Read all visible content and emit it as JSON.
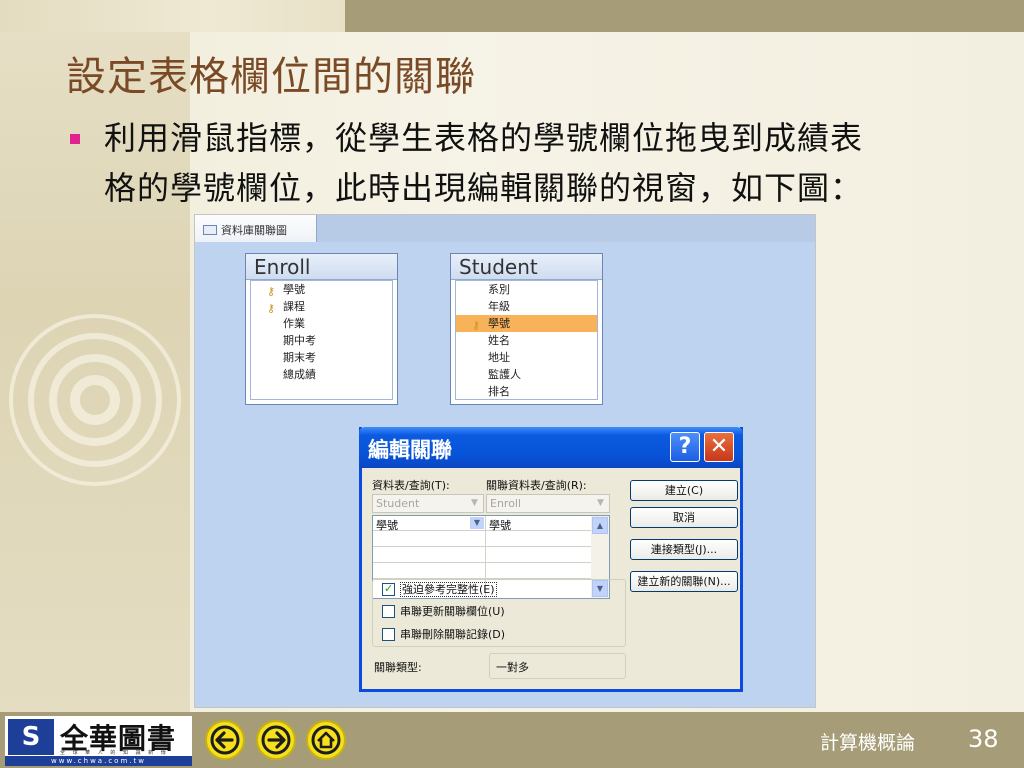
{
  "slide": {
    "title": "設定表格欄位間的關聯",
    "bullet_line1": "利用滑鼠指標，從學生表格的學號欄位拖曳到成績表",
    "bullet_line2": "格的學號欄位，此時出現編輯關聯的視窗，如下圖："
  },
  "screenshot": {
    "tab_label": "資料庫關聯圖",
    "tables": [
      {
        "name": "Enroll",
        "fields": [
          "學號",
          "課程",
          "作業",
          "期中考",
          "期末考",
          "總成績"
        ],
        "key_fields": [
          "學號",
          "課程"
        ]
      },
      {
        "name": "Student",
        "fields": [
          "系別",
          "年級",
          "學號",
          "姓名",
          "地址",
          "監護人",
          "排名"
        ],
        "key_fields": [
          "學號"
        ],
        "selected": "學號"
      }
    ]
  },
  "dialog": {
    "title": "編輯關聯",
    "help_label": "?",
    "close_label": "✕",
    "table_query_label": "資料表/查詢(T):",
    "related_table_query_label": "關聯資料表/查詢(R):",
    "table_value": "Student",
    "related_table_value": "Enroll",
    "field_left": "學號",
    "field_right": "學號",
    "buttons": {
      "create": "建立(C)",
      "cancel": "取消",
      "join_type": "連接類型(J)...",
      "create_new": "建立新的關聯(N)..."
    },
    "checkboxes": [
      {
        "label": "強迫參考完整性(E)",
        "checked": true
      },
      {
        "label": "串聯更新關聯欄位(U)",
        "checked": false
      },
      {
        "label": "串聯刪除關聯記錄(D)",
        "checked": false
      }
    ],
    "relationship_type_label": "關聯類型:",
    "relationship_type_value": "一對多"
  },
  "footer": {
    "logo_text": "全華圖書",
    "logo_sub": "全 球 華 人 的 知 識 新 傳",
    "logo_url": "www.chwa.com.tw",
    "course_name": "計算機概論",
    "page_number": "38"
  },
  "colors": {
    "title": "#7a4a26",
    "bullet": "#e0238e",
    "band": "#a69d78",
    "dialog_title": "#0853d8",
    "nav_button": "#f5e01b"
  }
}
